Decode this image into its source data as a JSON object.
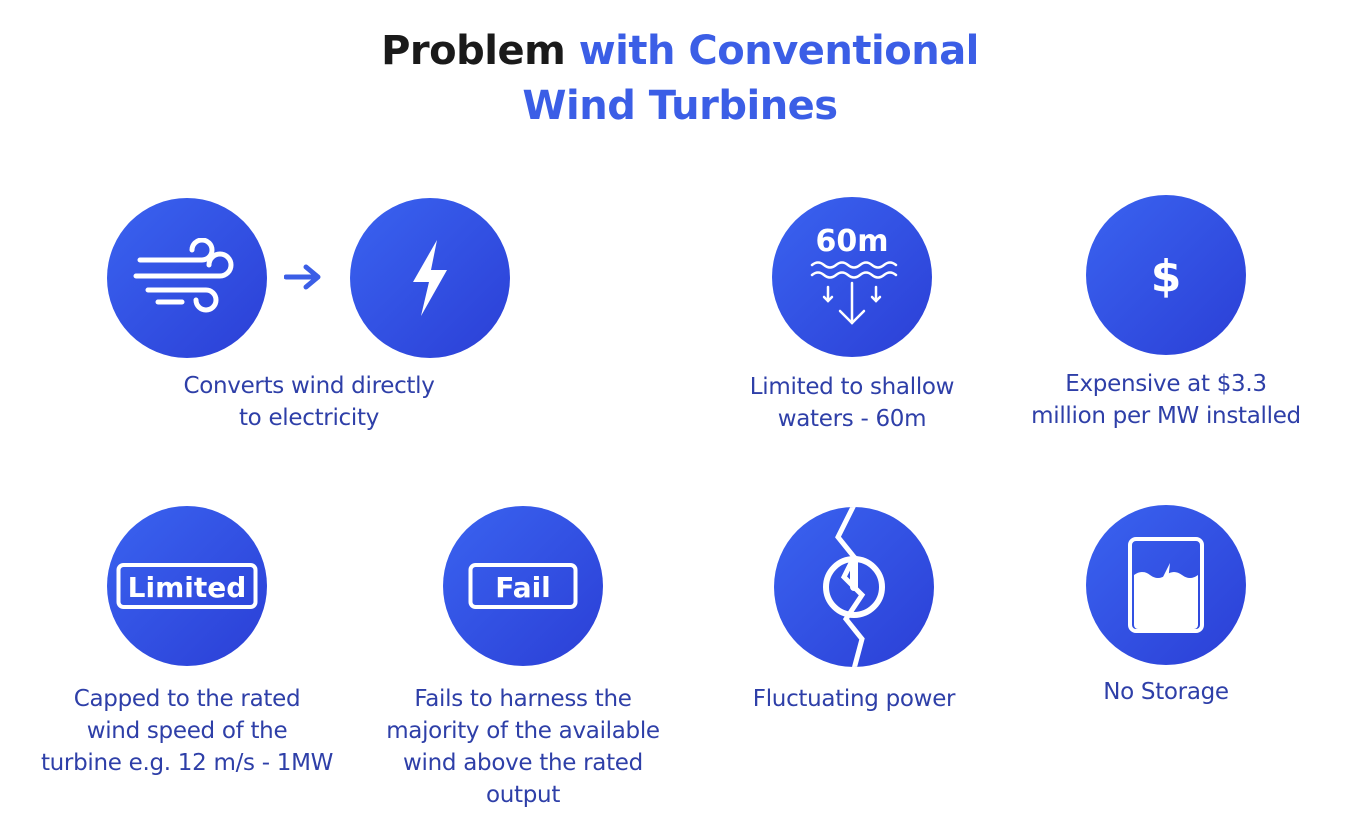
{
  "title": {
    "part1": "Problem",
    "part2": "with Conventional",
    "part3": "Wind Turbines"
  },
  "colors": {
    "circle": "#3355e8",
    "accent": "#3b5ee6",
    "caption": "#2e3fa8",
    "title_dark": "#1a1a1a"
  },
  "items": [
    {
      "icons": [
        "wind-icon",
        "arrow-right-icon",
        "lightning-bolt-icon"
      ],
      "caption_lines": [
        "Converts wind directly",
        "to electricity"
      ]
    },
    {
      "icons": [
        "water-depth-icon"
      ],
      "icon_text": "60m",
      "caption_lines": [
        "Limited to shallow",
        "waters - 60m"
      ]
    },
    {
      "icons": [
        "dollar-icon"
      ],
      "icon_text": "$",
      "caption_lines": [
        "Expensive at $3.3",
        "million per MW installed"
      ]
    },
    {
      "icons": [
        "limited-badge-icon"
      ],
      "icon_text": "Limited",
      "caption_lines": [
        "Capped to the rated",
        "wind speed of the",
        "turbine e.g. 12 m/s - 1MW"
      ]
    },
    {
      "icons": [
        "fail-badge-icon"
      ],
      "icon_text": "Fail",
      "caption_lines": [
        "Fails to harness the",
        "majority of the available",
        "wind above the rated",
        "output"
      ]
    },
    {
      "icons": [
        "broken-power-icon"
      ],
      "caption_lines": [
        "Fluctuating power"
      ]
    },
    {
      "icons": [
        "battery-storage-icon"
      ],
      "caption_lines": [
        "No Storage"
      ]
    }
  ]
}
